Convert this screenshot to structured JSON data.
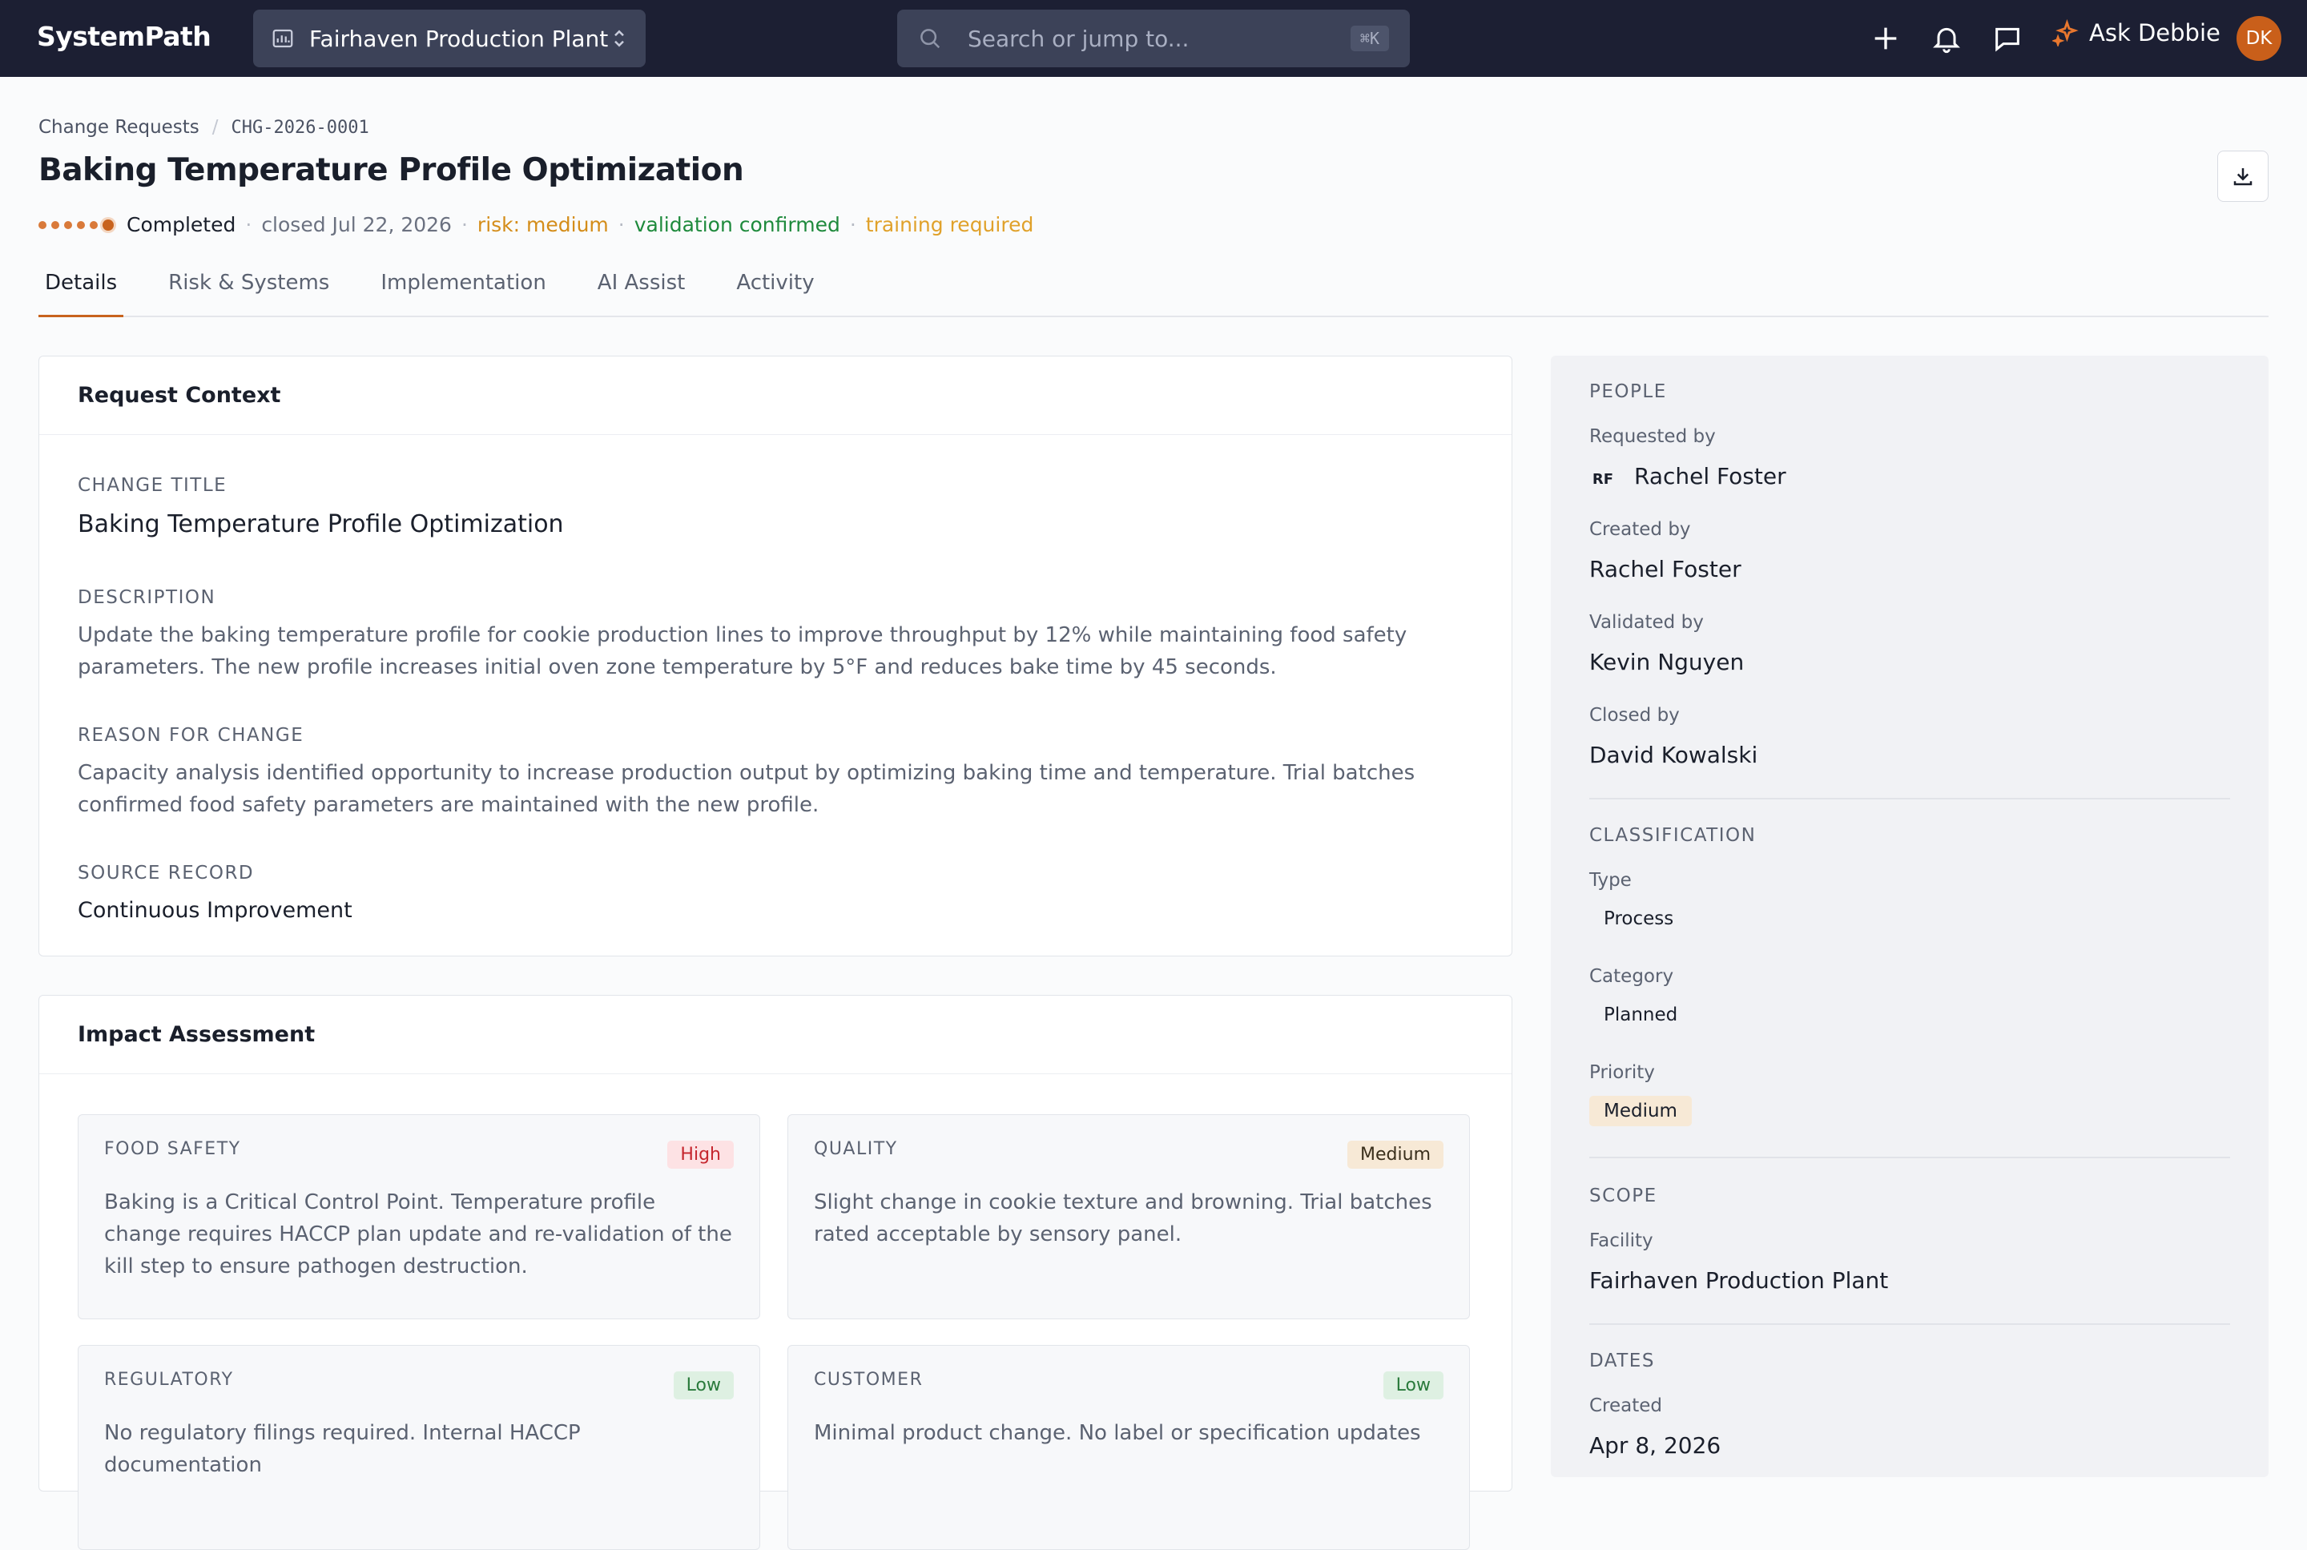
{
  "app": {
    "name": "SystemPath"
  },
  "topbar": {
    "facility": "Fairhaven Production Plant",
    "search_placeholder": "Search or jump to...",
    "search_shortcut": "⌘K",
    "ask_label": "Ask Debbie",
    "user_initials": "DK"
  },
  "breadcrumb": {
    "parent": "Change Requests",
    "current": "CHG-2026-0001"
  },
  "page": {
    "title": "Baking Temperature Profile Optimization"
  },
  "status": {
    "state": "Completed",
    "closed": "closed Jul 22, 2026",
    "risk": "risk: medium",
    "validation": "validation confirmed",
    "training": "training required",
    "progress_steps_total": 6,
    "progress_steps_done": 6
  },
  "tabs": [
    "Details",
    "Risk & Systems",
    "Implementation",
    "AI Assist",
    "Activity"
  ],
  "active_tab": "Details",
  "request_context": {
    "heading": "Request Context",
    "change_title_label": "CHANGE TITLE",
    "change_title": "Baking Temperature Profile Optimization",
    "description_label": "DESCRIPTION",
    "description": "Update the baking temperature profile for cookie production lines to improve throughput by 12% while maintaining food safety parameters. The new profile increases initial oven zone temperature by 5°F and reduces bake time by 45 seconds.",
    "reason_label": "REASON FOR CHANGE",
    "reason": "Capacity analysis identified opportunity to increase production output by optimizing baking time and temperature. Trial batches confirmed food safety parameters are maintained with the new profile.",
    "source_label": "SOURCE RECORD",
    "source": "Continuous Improvement"
  },
  "impact": {
    "heading": "Impact Assessment",
    "items": [
      {
        "label": "FOOD SAFETY",
        "level": "High",
        "text": "Baking is a Critical Control Point. Temperature profile change requires HACCP plan update and re-validation of the kill step to ensure pathogen destruction."
      },
      {
        "label": "QUALITY",
        "level": "Medium",
        "text": "Slight change in cookie texture and browning. Trial batches rated acceptable by sensory panel."
      },
      {
        "label": "REGULATORY",
        "level": "Low",
        "text": "No regulatory filings required. Internal HACCP documentation"
      },
      {
        "label": "CUSTOMER",
        "level": "Low",
        "text": "Minimal product change. No label or specification updates"
      }
    ]
  },
  "sidebar": {
    "people_label": "PEOPLE",
    "requested_by_label": "Requested by",
    "requested_by_initials": "RF",
    "requested_by": "Rachel Foster",
    "created_by_label": "Created by",
    "created_by": "Rachel Foster",
    "validated_by_label": "Validated by",
    "validated_by": "Kevin Nguyen",
    "closed_by_label": "Closed by",
    "closed_by": "David Kowalski",
    "classification_label": "CLASSIFICATION",
    "type_label": "Type",
    "type": "Process",
    "category_label": "Category",
    "category": "Planned",
    "priority_label": "Priority",
    "priority": "Medium",
    "scope_label": "SCOPE",
    "facility_label": "Facility",
    "facility": "Fairhaven Production Plant",
    "dates_label": "DATES",
    "created_label": "Created",
    "created": "Apr 8, 2026"
  }
}
